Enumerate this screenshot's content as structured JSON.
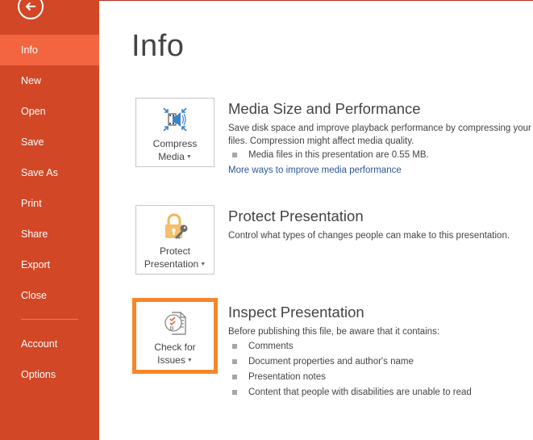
{
  "sidebar": {
    "back_icon": "back-arrow-icon",
    "items": [
      {
        "label": "Info",
        "active": true
      },
      {
        "label": "New"
      },
      {
        "label": "Open"
      },
      {
        "label": "Save"
      },
      {
        "label": "Save As"
      },
      {
        "label": "Print"
      },
      {
        "label": "Share"
      },
      {
        "label": "Export"
      },
      {
        "label": "Close"
      }
    ],
    "bottom_items": [
      {
        "label": "Account"
      },
      {
        "label": "Options"
      }
    ]
  },
  "page": {
    "title": "Info"
  },
  "sections": {
    "media": {
      "button_line1": "Compress",
      "button_line2": "Media",
      "icon": "compress-media-icon",
      "title": "Media Size and Performance",
      "description_line1": "Save disk space and improve playback performance by compressing your",
      "description_line2": "files. Compression might affect media quality.",
      "bullets": [
        "Media files in this presentation are 0.55 MB."
      ],
      "link": "More ways to improve media performance"
    },
    "protect": {
      "button_line1": "Protect",
      "button_line2": "Presentation",
      "icon": "lock-key-icon",
      "title": "Protect Presentation",
      "description": "Control what types of changes people can make to this presentation."
    },
    "inspect": {
      "button_line1": "Check for",
      "button_line2": "Issues",
      "icon": "check-issues-icon",
      "title": "Inspect Presentation",
      "description": "Before publishing this file, be aware that it contains:",
      "bullets": [
        "Comments",
        "Document properties and author's name",
        "Presentation notes",
        "Content that people with disabilities are unable to read"
      ]
    }
  },
  "colors": {
    "sidebar_bg": "#d24726",
    "sidebar_active": "#f26540",
    "highlight": "#f5862a",
    "link": "#2b579a"
  }
}
